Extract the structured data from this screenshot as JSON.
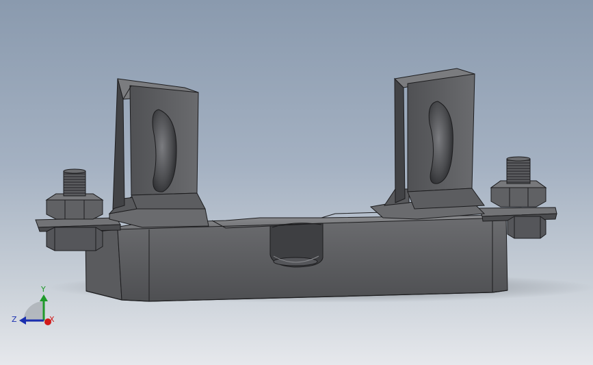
{
  "viewport": {
    "background_top": "#8a9aae",
    "background_bottom": "#e6e8ec",
    "model_color": "#5f6063",
    "edge_color": "#1c1c1e"
  },
  "model": {
    "parts": [
      "base-block",
      "left-contact-clip",
      "right-contact-clip",
      "left-bolt-nut",
      "right-bolt-nut",
      "left-terminal-plate",
      "right-terminal-plate",
      "center-slot"
    ]
  },
  "triad": {
    "x_label": "X",
    "y_label": "Y",
    "z_label": "Z",
    "x_color": "#d21a1a",
    "y_color": "#1f9a2a",
    "z_color": "#1a2fb0"
  }
}
